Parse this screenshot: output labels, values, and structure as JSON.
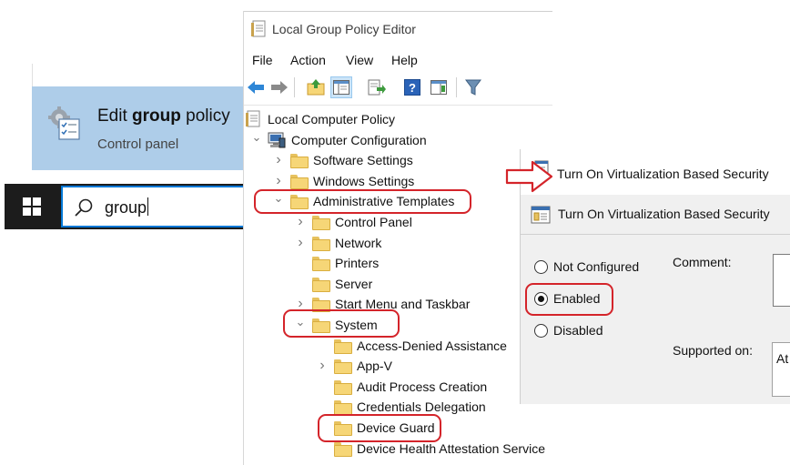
{
  "search": {
    "result_title_pre": "Edit ",
    "result_title_bold": "group",
    "result_title_post": " policy",
    "result_subtitle": "Control panel",
    "query": "group"
  },
  "gpe": {
    "title": "Local Group Policy Editor",
    "menu": [
      "File",
      "Action",
      "View",
      "Help"
    ],
    "toolbar_icons": [
      "back-arrow-icon",
      "forward-arrow-icon",
      "up-folder-icon",
      "show-hide-tree-icon",
      "export-list-icon",
      "help-icon",
      "extended-view-icon",
      "filter-icon"
    ],
    "tree": [
      {
        "label": "Local Computer Policy",
        "level": 0,
        "icon": "policy-document-icon",
        "chevron": ""
      },
      {
        "label": "Computer Configuration",
        "level": 1,
        "icon": "computer-icon",
        "chevron": "expanded"
      },
      {
        "label": "Software Settings",
        "level": 2,
        "icon": "folder-icon",
        "chevron": "collapsed"
      },
      {
        "label": "Windows Settings",
        "level": 2,
        "icon": "folder-icon",
        "chevron": "collapsed"
      },
      {
        "label": "Administrative Templates",
        "level": 2,
        "icon": "folder-icon",
        "chevron": "expanded"
      },
      {
        "label": "Control Panel",
        "level": 3,
        "icon": "folder-icon",
        "chevron": "collapsed"
      },
      {
        "label": "Network",
        "level": 3,
        "icon": "folder-icon",
        "chevron": "collapsed"
      },
      {
        "label": "Printers",
        "level": 3,
        "icon": "folder-icon",
        "chevron": ""
      },
      {
        "label": "Server",
        "level": 3,
        "icon": "folder-icon",
        "chevron": ""
      },
      {
        "label": "Start Menu and Taskbar",
        "level": 3,
        "icon": "folder-icon",
        "chevron": "collapsed"
      },
      {
        "label": "System",
        "level": 3,
        "icon": "folder-icon",
        "chevron": "expanded"
      },
      {
        "label": "Access-Denied Assistance",
        "level": 4,
        "icon": "folder-icon",
        "chevron": ""
      },
      {
        "label": "App-V",
        "level": 4,
        "icon": "folder-icon",
        "chevron": "collapsed"
      },
      {
        "label": "Audit Process Creation",
        "level": 4,
        "icon": "folder-icon",
        "chevron": ""
      },
      {
        "label": "Credentials Delegation",
        "level": 4,
        "icon": "folder-icon",
        "chevron": ""
      },
      {
        "label": "Device Guard",
        "level": 4,
        "icon": "folder-icon",
        "chevron": ""
      },
      {
        "label": "Device Health Attestation Service",
        "level": 4,
        "icon": "folder-icon",
        "chevron": ""
      }
    ]
  },
  "dialog": {
    "window_title": "Turn On Virtualization Based Security",
    "setting_title": "Turn On Virtualization Based Security",
    "options": [
      {
        "label": "Not Configured",
        "selected": false
      },
      {
        "label": "Enabled",
        "selected": true
      },
      {
        "label": "Disabled",
        "selected": false
      }
    ],
    "comment_label": "Comment:",
    "supported_label": "Supported on:",
    "supported_value": "At"
  },
  "colors": {
    "highlight_red": "#d4242a",
    "result_tile": "#aecde9",
    "taskbar": "#1c1c1c",
    "search_border": "#0078d7",
    "folder": "#f6d677"
  }
}
